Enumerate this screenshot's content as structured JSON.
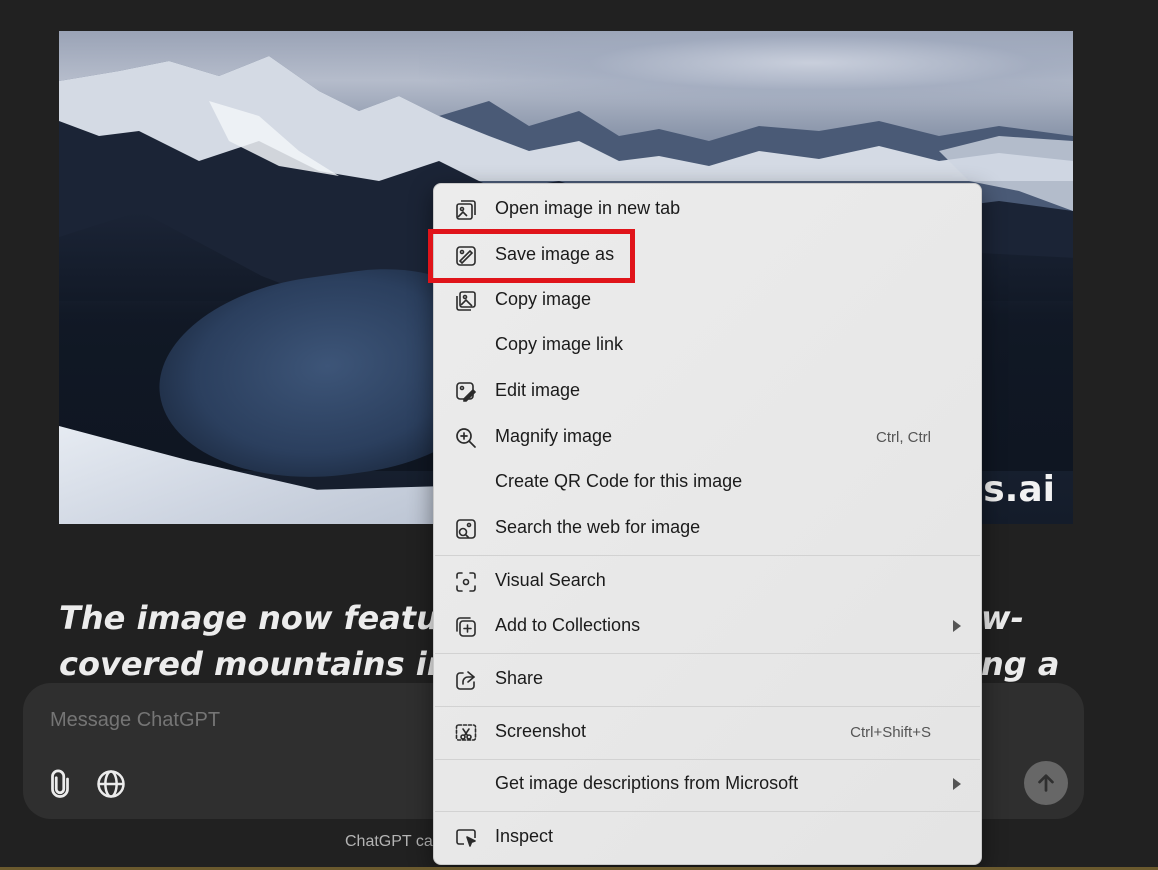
{
  "image": {
    "watermark": "ns.ai"
  },
  "response": {
    "line1_start": "The image now features",
    "line1_end": "w-",
    "line2_start": "covered mountains in a w",
    "line2_end": "ng a"
  },
  "composer": {
    "placeholder": "Message ChatGPT",
    "attach_icon": "paperclip-icon",
    "web_icon": "globe-icon",
    "send_icon": "arrow-up-icon"
  },
  "disclaimer": "ChatGPT ca",
  "context_menu": {
    "items": [
      {
        "label": "Open image in new tab",
        "icon": "open-in-new-tab-icon"
      },
      {
        "label": "Save image as",
        "icon": "save-image-icon"
      },
      {
        "label": "Copy image",
        "icon": "copy-image-icon"
      },
      {
        "label": "Copy image link",
        "icon": ""
      },
      {
        "label": "Edit image",
        "icon": "edit-image-icon"
      },
      {
        "label": "Magnify image",
        "icon": "magnify-icon",
        "shortcut": "Ctrl, Ctrl"
      },
      {
        "label": "Create QR Code for this image",
        "icon": ""
      },
      {
        "label": "Search the web for image",
        "icon": "image-search-icon"
      },
      {
        "label": "Visual Search",
        "icon": "visual-search-icon"
      },
      {
        "label": "Add to Collections",
        "icon": "collections-icon"
      },
      {
        "label": "Share",
        "icon": "share-icon"
      },
      {
        "label": "Screenshot",
        "icon": "screenshot-icon",
        "shortcut": "Ctrl+Shift+S"
      },
      {
        "label": "Get image descriptions from Microsoft",
        "icon": ""
      },
      {
        "label": "Inspect",
        "icon": "inspect-icon"
      }
    ]
  },
  "colors": {
    "highlight": "#e0141a",
    "background": "#212121",
    "menu_bg": "#ececec"
  }
}
